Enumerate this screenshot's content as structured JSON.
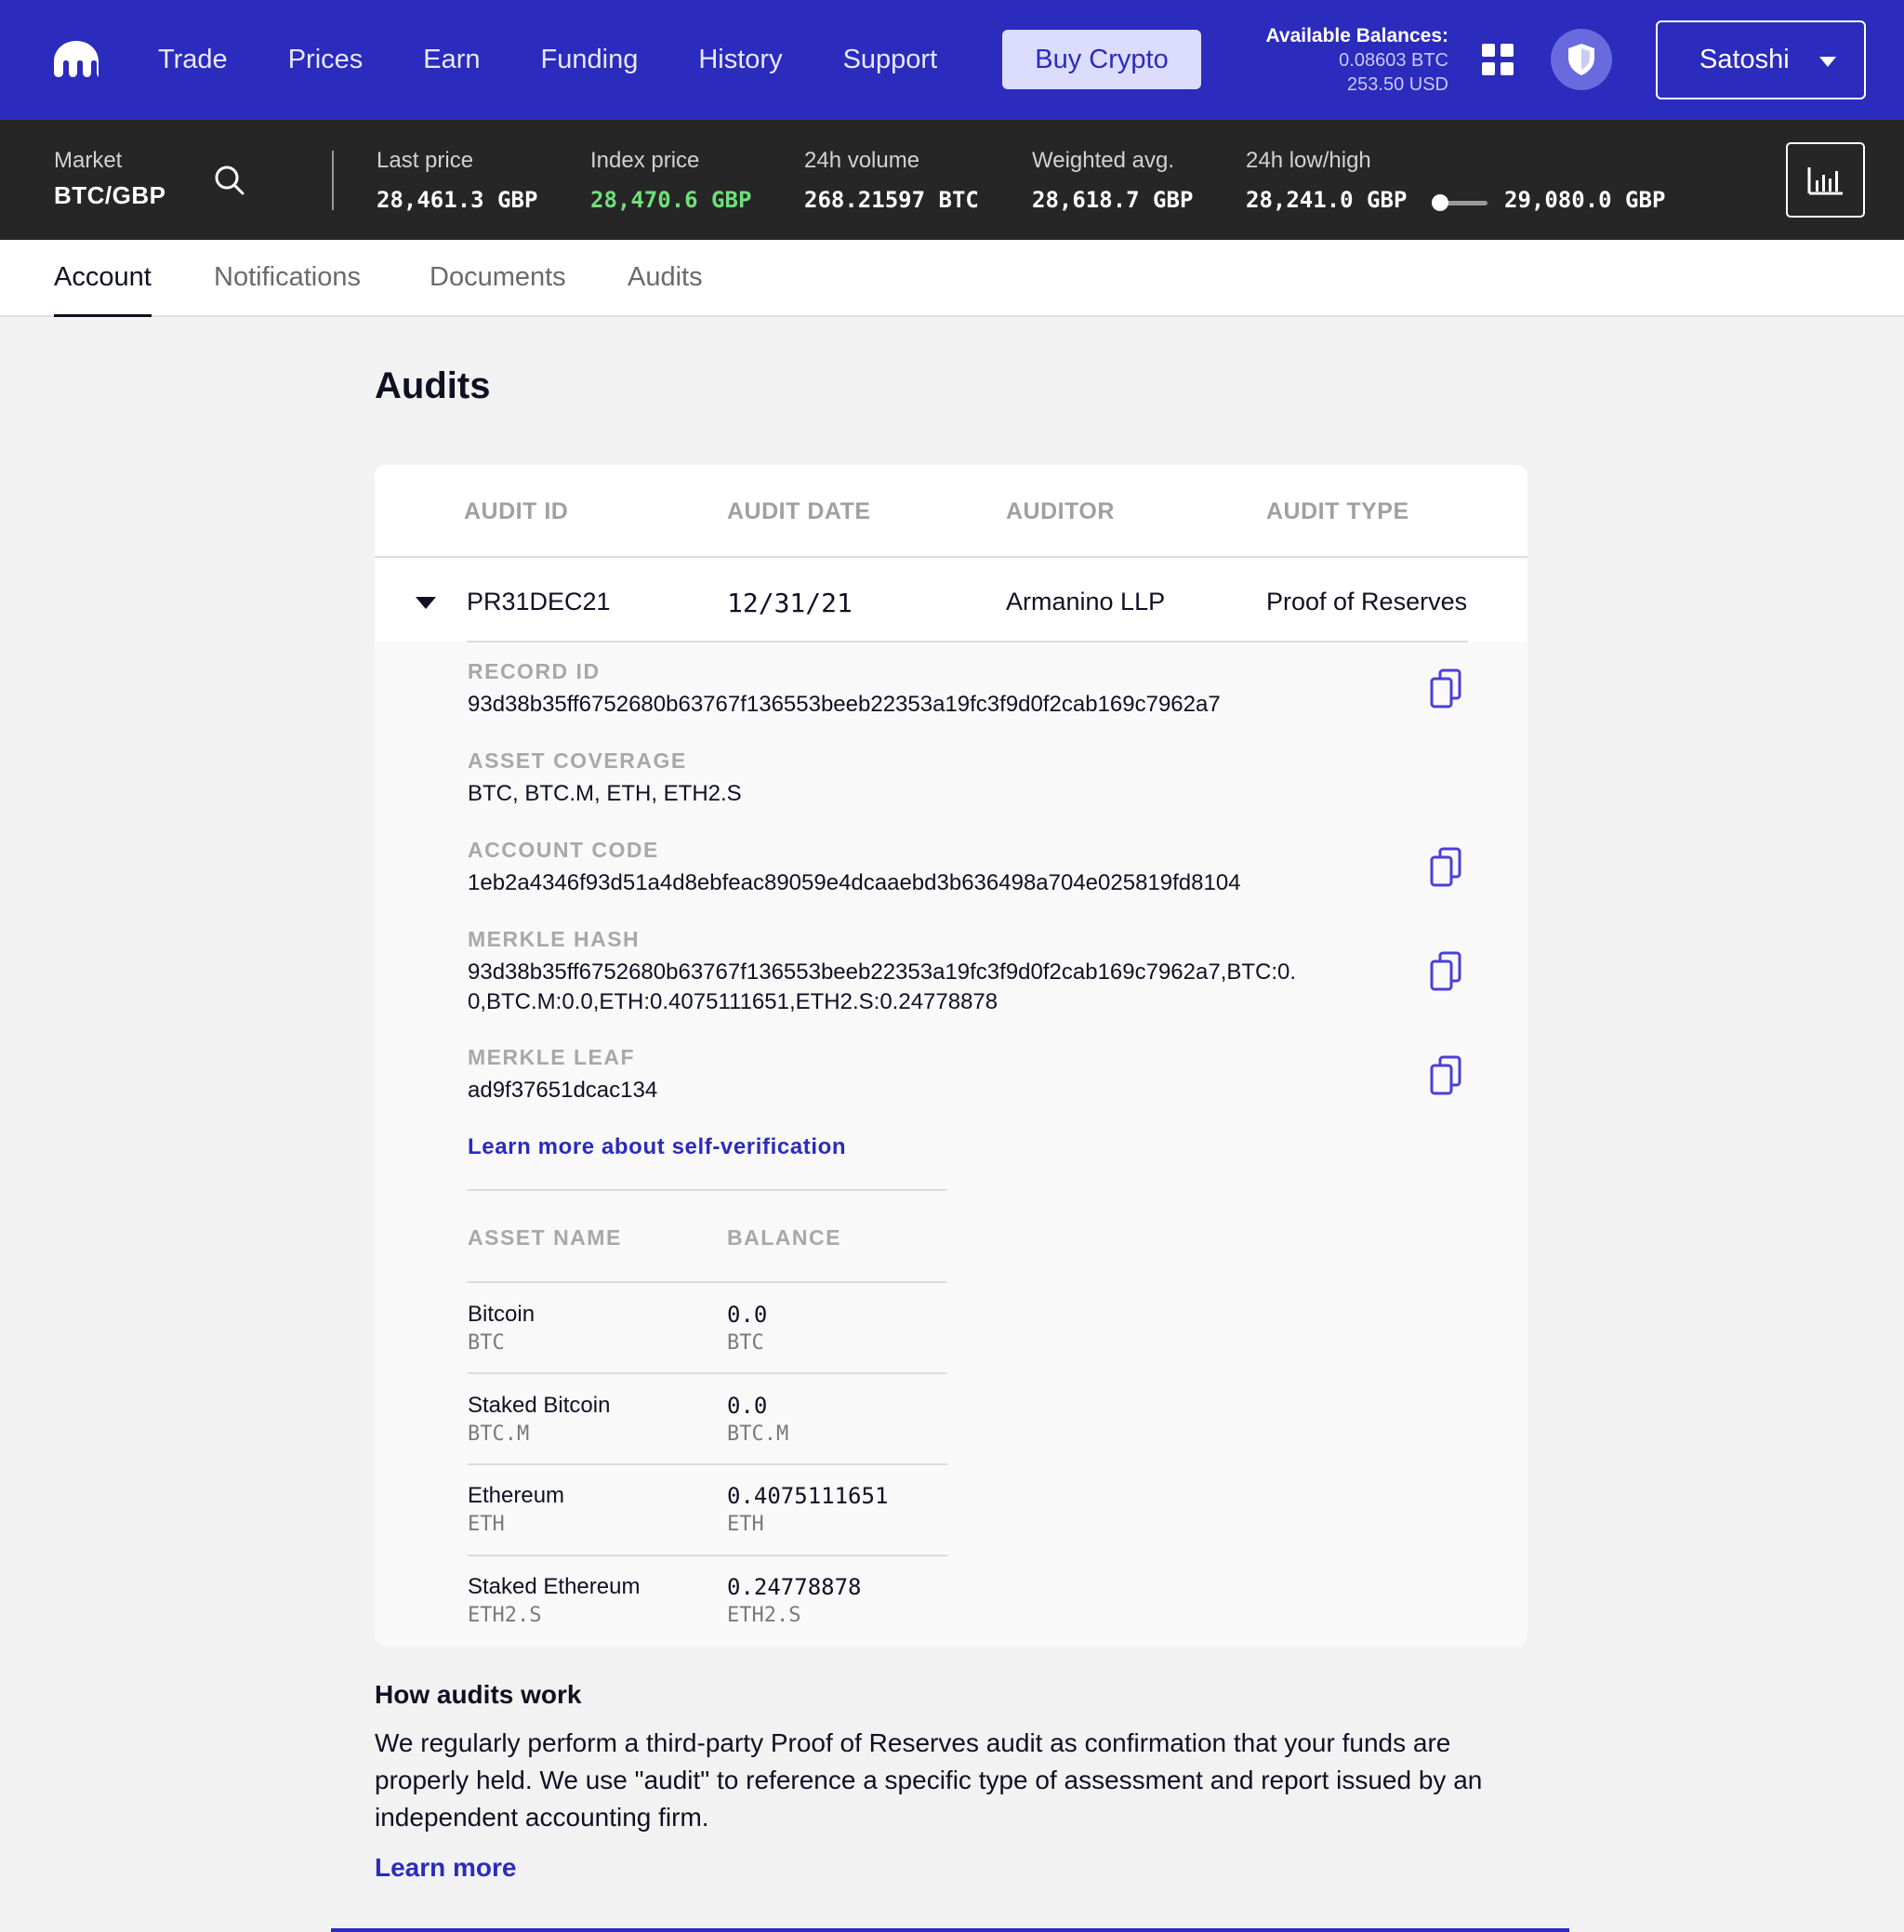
{
  "nav": {
    "links": [
      "Trade",
      "Prices",
      "Earn",
      "Funding",
      "History",
      "Support"
    ],
    "buy_label": "Buy Crypto",
    "balances_title": "Available Balances:",
    "balance_btc": "0.08603 BTC",
    "balance_usd": "253.50 USD",
    "user_name": "Satoshi",
    "brand_color": "#2b2bbd"
  },
  "market": {
    "label": "Market",
    "pair": "BTC/GBP",
    "stats": {
      "last_price": {
        "label": "Last price",
        "value": "28,461.3 GBP"
      },
      "index_price": {
        "label": "Index price",
        "value": "28,470.6 GBP",
        "color": "#6fe07a"
      },
      "volume": {
        "label": "24h volume",
        "value": "268.21597 BTC"
      },
      "weighted": {
        "label": "Weighted avg.",
        "value": "28,618.7 GBP"
      },
      "lowhigh": {
        "label": "24h low/high",
        "low": "28,241.0 GBP",
        "high": "29,080.0 GBP"
      }
    }
  },
  "tabs": [
    "Account",
    "Notifications",
    "Documents",
    "Audits"
  ],
  "active_tab": "Account",
  "page_title": "Audits",
  "table": {
    "headers": [
      "AUDIT ID",
      "AUDIT DATE",
      "AUDITOR",
      "AUDIT TYPE"
    ],
    "row": {
      "id": "PR31DEC21",
      "date": "12/31/21",
      "auditor": "Armanino LLP",
      "type": "Proof of Reserves"
    }
  },
  "details": {
    "record_id": {
      "label": "RECORD ID",
      "value": "93d38b35ff6752680b63767f136553beeb22353a19fc3f9d0f2cab169c7962a7"
    },
    "asset_coverage": {
      "label": "ASSET COVERAGE",
      "value": "BTC, BTC.M, ETH, ETH2.S"
    },
    "account_code": {
      "label": "ACCOUNT CODE",
      "value": "1eb2a4346f93d51a4d8ebfeac89059e4dcaaebd3b636498a704e025819fd8104"
    },
    "merkle_hash": {
      "label": "MERKLE HASH",
      "line1": "93d38b35ff6752680b63767f136553beeb22353a19fc3f9d0f2cab169c7962a7,BTC:0.",
      "line2": "0,BTC.M:0.0,ETH:0.4075111651,ETH2.S:0.24778878"
    },
    "merkle_leaf": {
      "label": "MERKLE LEAF",
      "value": "ad9f37651dcac134"
    },
    "learn_link": "Learn more about self-verification"
  },
  "assets": {
    "headers": [
      "ASSET NAME",
      "BALANCE"
    ],
    "rows": [
      {
        "name": "Bitcoin",
        "symbol": "BTC",
        "balance": "0.0",
        "balance_symbol": "BTC"
      },
      {
        "name": "Staked Bitcoin",
        "symbol": "BTC.M",
        "balance": "0.0",
        "balance_symbol": "BTC.M"
      },
      {
        "name": "Ethereum",
        "symbol": "ETH",
        "balance": "0.4075111651",
        "balance_symbol": "ETH"
      },
      {
        "name": "Staked Ethereum",
        "symbol": "ETH2.S",
        "balance": "0.24778878",
        "balance_symbol": "ETH2.S"
      }
    ]
  },
  "how": {
    "title": "How audits work",
    "text": "We regularly perform a third-party Proof of Reserves audit as confirmation that your funds are properly held. We use \"audit\" to reference a specific type of assessment and report issued by an independent accounting firm.",
    "learn_more": "Learn more"
  }
}
